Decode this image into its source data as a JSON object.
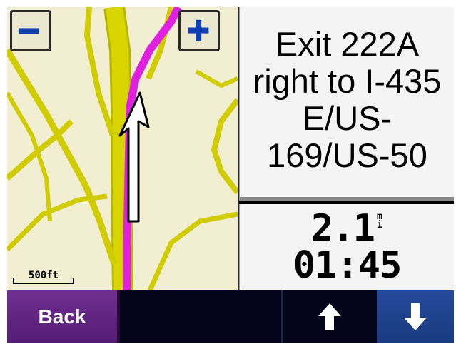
{
  "map": {
    "scale_label": "500ft",
    "zoom_out_icon": "minus-icon",
    "zoom_in_icon": "plus-icon",
    "position_icon": "vehicle-arrow-icon"
  },
  "instruction": {
    "text": "Exit 222A right to I-435 E/US-169/US-50"
  },
  "info": {
    "distance_value": "2.1",
    "distance_unit": "mi",
    "time_value": "01:45"
  },
  "bottom_bar": {
    "back_label": "Back",
    "up_icon": "arrow-up-icon",
    "down_icon": "arrow-down-icon"
  },
  "colors": {
    "route": "#e020e0",
    "road": "#d8d400",
    "map_bg": "#f2eed2",
    "back_button": "#6a2a8a",
    "down_button": "#1f4390",
    "bar_bg": "#04041a"
  }
}
